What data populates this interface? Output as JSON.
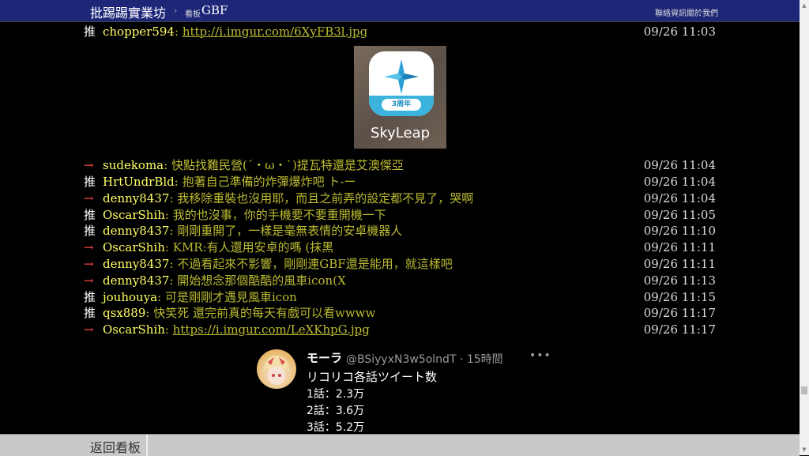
{
  "header": {
    "site_name": "批踢踢實業坊",
    "breadcrumb_separator": "›",
    "board_prefix": "看板",
    "board_name": "GBF",
    "links": {
      "contact": "聯絡資訊",
      "about": "關於我們"
    }
  },
  "pushes": [
    {
      "tag": "推",
      "type": "push",
      "user": "chopper594",
      "content": "http://i.imgur.com/6XyFB3l.jpg",
      "is_link": true,
      "time": "09/26 11:03"
    },
    {
      "tag": "→",
      "type": "arrow",
      "user": "sudekoma",
      "content": "快點找難民營(´・ω・`)提瓦特還是艾澳傑亞",
      "is_link": false,
      "time": "09/26 11:04"
    },
    {
      "tag": "推",
      "type": "push",
      "user": "HrtUndrBld",
      "content": "抱著自己準備的炸彈爆炸吧 ト-ー",
      "is_link": false,
      "time": "09/26 11:04"
    },
    {
      "tag": "→",
      "type": "arrow",
      "user": "denny8437",
      "content": "我移除重裝也沒用耶，而且之前弄的設定都不見了，哭啊",
      "is_link": false,
      "time": "09/26 11:04"
    },
    {
      "tag": "推",
      "type": "push",
      "user": "OscarShih",
      "content": "我的也沒事，你的手機要不要重開機一下",
      "is_link": false,
      "time": "09/26 11:05"
    },
    {
      "tag": "推",
      "type": "push",
      "user": "denny8437",
      "content": "剛剛重開了，一樣是毫無表情的安卓機器人",
      "is_link": false,
      "time": "09/26 11:10"
    },
    {
      "tag": "→",
      "type": "arrow",
      "user": "OscarShih",
      "content": "KMR:有人還用安卓的嗎 (抹黑",
      "is_link": false,
      "time": "09/26 11:11"
    },
    {
      "tag": "→",
      "type": "arrow",
      "user": "denny8437",
      "content": "不過看起來不影響，剛剛連GBF還是能用，就這樣吧",
      "is_link": false,
      "time": "09/26 11:11"
    },
    {
      "tag": "→",
      "type": "arrow",
      "user": "denny8437",
      "content": "開始想念那個酷酷的風車icon(X",
      "is_link": false,
      "time": "09/26 11:13"
    },
    {
      "tag": "推",
      "type": "push",
      "user": "jouhouya",
      "content": "可是剛剛才遇見風車icon",
      "is_link": false,
      "time": "09/26 11:15"
    },
    {
      "tag": "推",
      "type": "push",
      "user": "qsx889",
      "content": "快笑死 還完前真的每天有戲可以看wwww",
      "is_link": false,
      "time": "09/26 11:17"
    },
    {
      "tag": "→",
      "type": "arrow",
      "user": "OscarShih",
      "content": "https://i.imgur.com/LeXKhpG.jpg",
      "is_link": true,
      "time": "09/26 11:17"
    }
  ],
  "image": {
    "app_name": "SkyLeap",
    "badge_text": "3周年"
  },
  "tweet": {
    "display_name": "モーラ",
    "handle_line": "@BSiyyxN3w5olndT · 15時間",
    "more": "•••",
    "lines": [
      "リコリコ各話ツイート数",
      "1話：2.3万",
      "2話：3.6万",
      "3話：5.2万"
    ]
  },
  "footer": {
    "back_label": "返回看板"
  },
  "scrollbar": {
    "up_arrow": "▲",
    "down_arrow": "▼"
  },
  "colors": {
    "header_bg": "#1d2677",
    "push_tag": "#ffffff",
    "arrow_tag": "#ff4444",
    "user_id": "#ffff66",
    "content": "#bbbb33",
    "time": "#dddddd"
  }
}
